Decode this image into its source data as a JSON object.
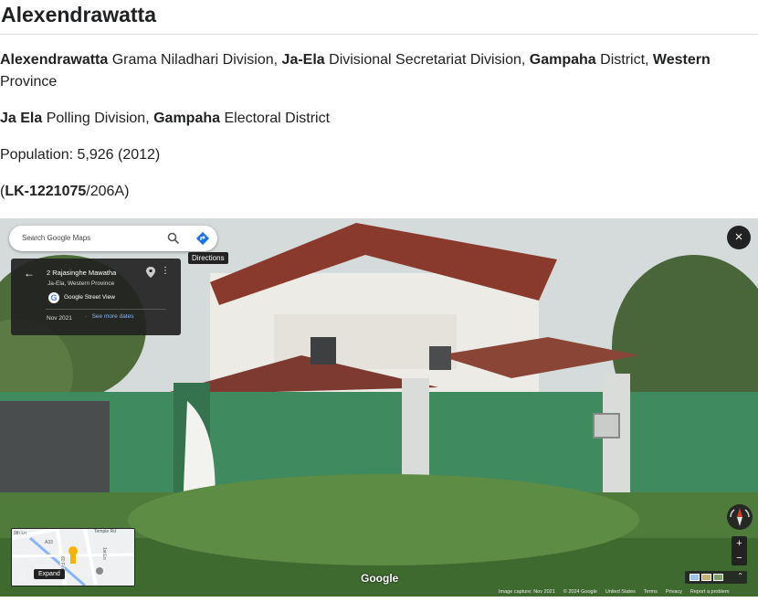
{
  "page": {
    "title": "Alexendrawatta",
    "division_line": {
      "gn": "Alexendrawatta",
      "gn_suffix": " Grama Niladhari Division, ",
      "ds": "Ja-Ela",
      "ds_suffix": " Divisional Secretariat Division, ",
      "district": "Gampaha",
      "district_suffix": " District, ",
      "province": "Western",
      "province_suffix": " Province"
    },
    "polling_line": {
      "polling": "Ja Ela",
      "polling_suffix": " Polling Division, ",
      "electoral": "Gampaha",
      "electoral_suffix": " Electoral District"
    },
    "population": "Population: 5,926 (2012)",
    "code_line": {
      "open": "(",
      "code": "LK-1221075",
      "rest": "/206A)"
    }
  },
  "street_view": {
    "search_placeholder": "Search Google Maps",
    "directions_tooltip": "Directions",
    "close_label": "×",
    "info_card": {
      "back": "←",
      "address": "2 Rajasinghe Mawatha",
      "area": "Ja-Ela, Western Province",
      "provider": "Google Street View",
      "date": "Nov 2021",
      "dot": "·",
      "see_more": "See more dates",
      "more": "⋮"
    },
    "minimap": {
      "expand_label": "Expand",
      "expand_icon": "⛶",
      "road_labels": [
        "9th Ln",
        "60 Feet Rd",
        "Temple Rd",
        "A33",
        "1st Ln"
      ]
    },
    "google_logo": "Google",
    "footer": {
      "capture": "Image capture: Nov 2021",
      "copyright": "© 2024 Google",
      "country": "United States",
      "terms": "Terms",
      "privacy": "Privacy",
      "report": "Report a problem"
    },
    "zoom_in": "+",
    "zoom_out": "−",
    "collapse": "⌃"
  },
  "colors": {
    "wall_green": "#3f8a5e",
    "roof_red": "#8a3a2c",
    "link_blue": "#8ab4f8"
  },
  "icons": [
    "search-icon",
    "directions-icon",
    "close-icon",
    "back-arrow-icon",
    "map-pin-icon",
    "more-vert-icon",
    "compass-icon",
    "pegman-icon"
  ]
}
